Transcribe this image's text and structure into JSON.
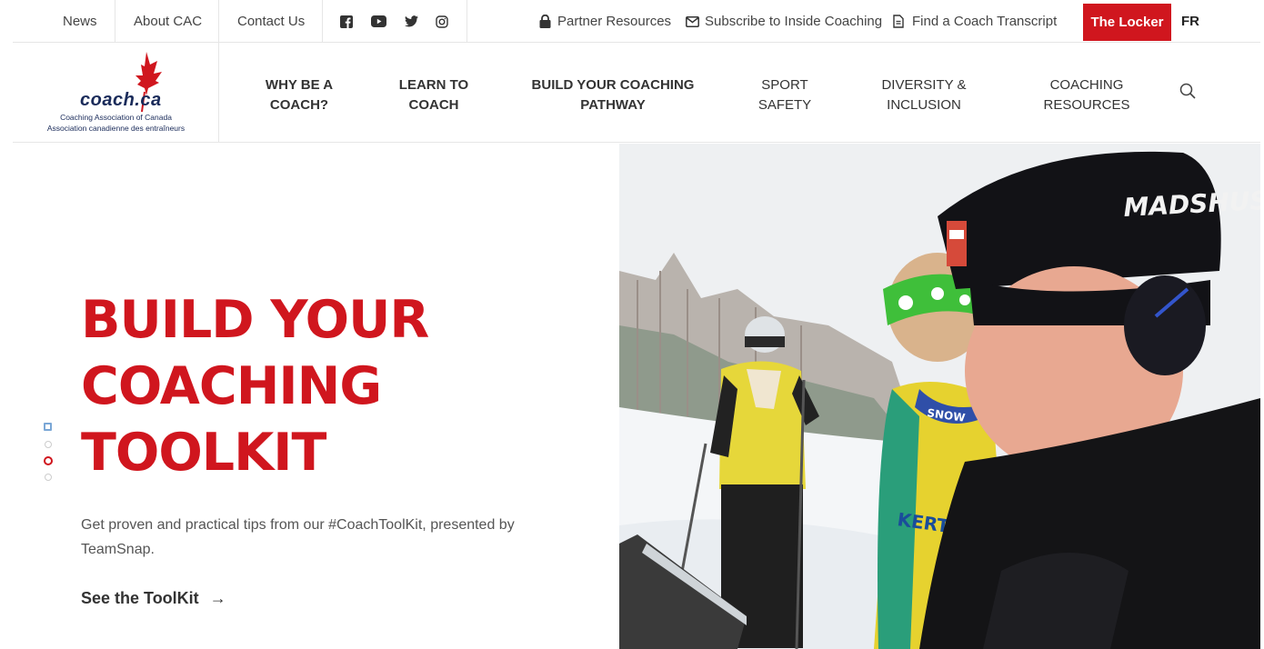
{
  "topbar": {
    "news": "News",
    "about": "About CAC",
    "contact": "Contact Us",
    "social_icons": [
      "facebook-icon",
      "youtube-icon",
      "twitter-icon",
      "instagram-icon"
    ],
    "partner": "Partner Resources",
    "subscribe": "Subscribe to Inside Coaching",
    "transcript": "Find a Coach Transcript",
    "locker": "The Locker",
    "language": "FR"
  },
  "logo": {
    "wordmark": "coach.ca",
    "subtitle_en": "Coaching Association of Canada",
    "subtitle_fr": "Association canadienne des entraîneurs"
  },
  "nav": {
    "items": [
      {
        "line1": "WHY BE A",
        "line2": "COACH?"
      },
      {
        "line1": "LEARN TO",
        "line2": "COACH"
      },
      {
        "line1": "BUILD YOUR COACHING",
        "line2": "PATHWAY"
      },
      {
        "line1": "SPORT",
        "line2": "SAFETY"
      },
      {
        "line1": "DIVERSITY &",
        "line2": "INCLUSION"
      },
      {
        "line1": "COACHING",
        "line2": "RESOURCES"
      }
    ]
  },
  "hero": {
    "title_lines": [
      "BUILD YOUR",
      "COACHING",
      "TOOLKIT"
    ],
    "description": "Get proven and practical tips from our #CoachToolKit, presented by TeamSnap.",
    "cta": "See the ToolKit",
    "cta_arrow": "→",
    "slides_total": 4,
    "active_slide": 3,
    "image_alt": "Cross-country ski coach reviewing notes with athletes in snow",
    "image_text_hat": "MADSHUS",
    "image_text_bib": "KERTO",
    "image_text_scarf": "SNOW"
  },
  "colors": {
    "brand_red": "#d0161e",
    "navy": "#1a2b5a",
    "text": "#333333"
  }
}
